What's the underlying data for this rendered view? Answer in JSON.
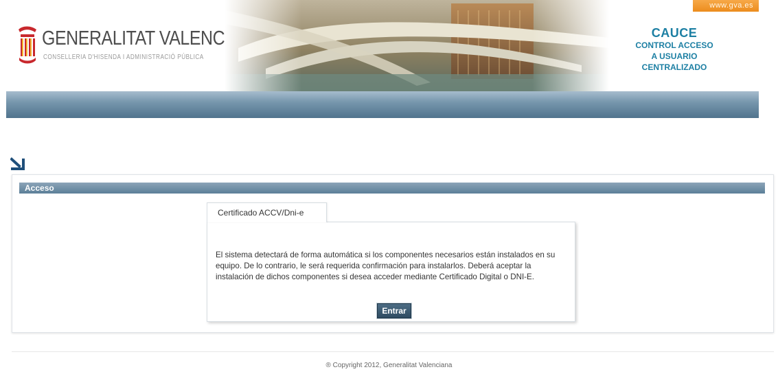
{
  "header": {
    "logo_title": "GENERALITAT VALENCIANA",
    "logo_subtitle": "CONSELLERIA D'HISENDA I ADMINISTRACIÓ PÚBLICA",
    "gva_link": "www.gva.es",
    "app_name": "CAUCE",
    "app_subtitle": [
      "CONTROL ACCESO",
      "A USUARIO",
      "CENTRALIZADO"
    ]
  },
  "section": {
    "title": "Acceso"
  },
  "tabs": [
    {
      "label": "Certificado ACCV/Dni-e",
      "active": true
    }
  ],
  "certificate_panel": {
    "description": "El sistema detectará de forma automática si los componentes necesarios están instalados en su equipo. De lo contrario, le será requerida confirmación para instalarlos. Deberá aceptar la instalación de dichos componentes si desea acceder mediante Certificado Digital o DNI-E.",
    "button_label": "Entrar"
  },
  "footer": {
    "copyright": "® Copyright 2012, Generalitat Valenciana"
  },
  "colors": {
    "brand_teal": "#1c7fa3",
    "navbar_blue": "#50738d",
    "button_blue": "#2e4b61",
    "gva_orange": "#ec8c1d"
  },
  "icons": [
    "generalitat-logo-icon",
    "arrow-down-right-icon"
  ]
}
